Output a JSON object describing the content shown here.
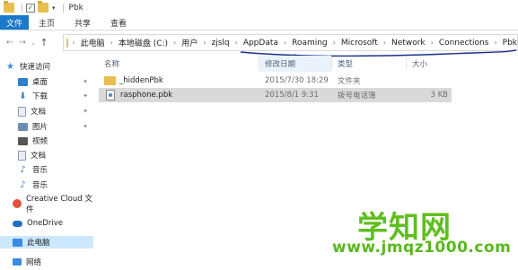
{
  "window": {
    "title": "Pbk"
  },
  "ribbon": {
    "file_tab": "文件",
    "tabs": [
      "主页",
      "共享",
      "查看"
    ]
  },
  "address": {
    "crumbs": [
      "此电脑",
      "本地磁盘 (C:)",
      "用户",
      "zjslq",
      "AppData",
      "Roaming",
      "Microsoft",
      "Network",
      "Connections",
      "Pbk"
    ]
  },
  "sidebar": {
    "items": [
      {
        "label": "快速访问",
        "icon": "star-icon",
        "color": "#3a8de0"
      },
      {
        "label": "桌面",
        "icon": "desktop-icon",
        "color": "#2f7fd1"
      },
      {
        "label": "下载",
        "icon": "download-icon",
        "color": "#2f7fd1"
      },
      {
        "label": "文档",
        "icon": "document-icon",
        "color": "#8a9bb0"
      },
      {
        "label": "图片",
        "icon": "pictures-icon",
        "color": "#6b8fb3"
      },
      {
        "label": "视频",
        "icon": "video-icon",
        "color": "#555555"
      },
      {
        "label": "文档",
        "icon": "document-icon",
        "color": "#8a9bb0"
      },
      {
        "label": "音乐",
        "icon": "music-icon",
        "color": "#3a7fc6"
      },
      {
        "label": "音乐",
        "icon": "music-icon",
        "color": "#3a7fc6"
      },
      {
        "label": "Creative Cloud 文件",
        "icon": "creative-cloud-icon",
        "color": "#e0533b"
      },
      {
        "label": "OneDrive",
        "icon": "onedrive-icon",
        "color": "#1f6fc5"
      },
      {
        "label": "此电脑",
        "icon": "computer-icon",
        "color": "#3a8de0"
      },
      {
        "label": "网络",
        "icon": "network-icon",
        "color": "#3a8de0"
      }
    ]
  },
  "columns": {
    "name": "名称",
    "date": "修改日期",
    "type": "类型",
    "size": "大小"
  },
  "files": [
    {
      "name": "_hiddenPbk",
      "date": "2015/7/30 18:29",
      "type": "文件夹",
      "size": "",
      "icon": "folder-icon"
    },
    {
      "name": "rasphone.pbk",
      "date": "2015/8/1 9:31",
      "type": "拨号电话簿",
      "size": "3 KB",
      "icon": "phonebook-file-icon"
    }
  ],
  "watermark": {
    "title": "学知网",
    "url": "www.jmqz1000.com"
  },
  "colors": {
    "accent": "#1979ca",
    "annotation": "#1a2f8a",
    "watermark": "#5fbf1f"
  }
}
